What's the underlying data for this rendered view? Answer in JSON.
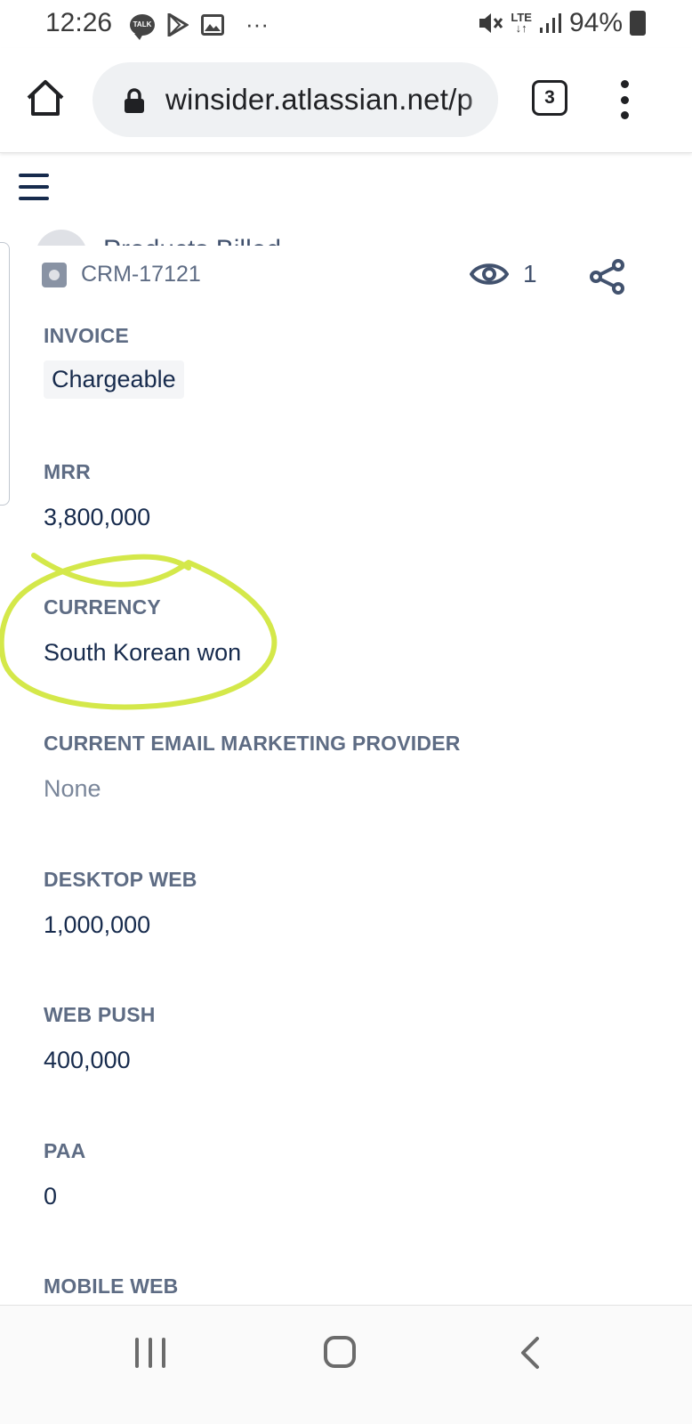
{
  "status_bar": {
    "time": "12:26",
    "talk_badge": "TALK",
    "more": "···",
    "network": "LTE",
    "battery": "94%"
  },
  "browser": {
    "url": "winsider.atlassian.net/p",
    "tab_count": "3"
  },
  "page": {
    "behind_text": "Products Billed",
    "issue_key": "CRM-17121",
    "watch_count": "1",
    "fields": [
      {
        "label": "INVOICE",
        "value": "Chargeable"
      },
      {
        "label": "MRR",
        "value": "3,800,000"
      },
      {
        "label": "CURRENCY",
        "value": "South Korean won"
      },
      {
        "label": "CURRENT EMAIL MARKETING PROVIDER",
        "value": "None"
      },
      {
        "label": "DESKTOP WEB",
        "value": "1,000,000"
      },
      {
        "label": "WEB PUSH",
        "value": "400,000"
      },
      {
        "label": "PAA",
        "value": "0"
      },
      {
        "label": "MOBILE WEB",
        "value": ""
      }
    ]
  },
  "colors": {
    "annotation": "#d4e84a",
    "label": "#5e6c84",
    "text": "#172b4d"
  }
}
